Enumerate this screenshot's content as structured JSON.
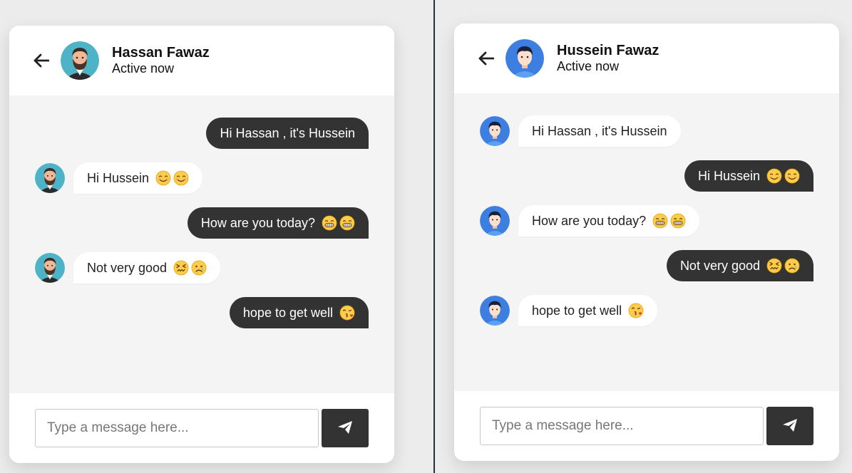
{
  "left_chat": {
    "contact_name": "Hassan Fawaz",
    "status": "Active now",
    "input_placeholder": "Type a message here...",
    "messages": [
      {
        "dir": "out",
        "text": "Hi Hassan , it's Hussein",
        "emojis": []
      },
      {
        "dir": "in",
        "text": "Hi Hussein",
        "emojis": [
          "smiling-face-icon",
          "smiling-face-icon"
        ]
      },
      {
        "dir": "out",
        "text": "How are you today?",
        "emojis": [
          "grinning-face-icon",
          "grinning-face-icon"
        ]
      },
      {
        "dir": "in",
        "text": "Not very good",
        "emojis": [
          "confounded-face-icon",
          "sad-face-icon"
        ]
      },
      {
        "dir": "out",
        "text": "hope to get well",
        "emojis": [
          "kissing-face-icon"
        ]
      }
    ]
  },
  "right_chat": {
    "contact_name": "Hussein Fawaz",
    "status": "Active now",
    "input_placeholder": "Type a message here...",
    "messages": [
      {
        "dir": "in",
        "text": "Hi Hassan , it's Hussein",
        "emojis": []
      },
      {
        "dir": "out",
        "text": "Hi Hussein",
        "emojis": [
          "smiling-face-icon",
          "smiling-face-icon"
        ]
      },
      {
        "dir": "in",
        "text": "How are you today?",
        "emojis": [
          "grinning-face-icon",
          "grinning-face-icon"
        ]
      },
      {
        "dir": "out",
        "text": "Not very good",
        "emojis": [
          "confounded-face-icon",
          "sad-face-icon"
        ]
      },
      {
        "dir": "in",
        "text": "hope to get well",
        "emojis": [
          "kissing-face-icon"
        ]
      }
    ]
  },
  "colors": {
    "dark_bubble": "#333333",
    "light_bubble": "#ffffff",
    "chat_background": "#f4f4f4",
    "hassan_avatar_bg": "#4fb3c8",
    "hussein_avatar_bg": "#3d7fe0"
  }
}
